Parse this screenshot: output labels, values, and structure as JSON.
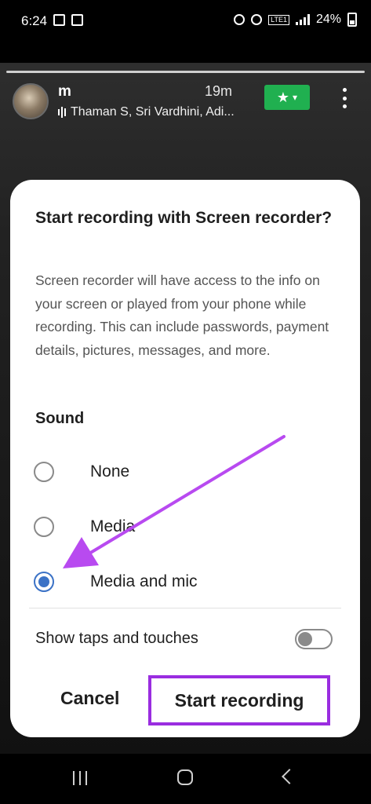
{
  "status_bar": {
    "time": "6:24",
    "network": "LTE1",
    "battery": "24%"
  },
  "app": {
    "chat_title": "m",
    "time_ago": "19m",
    "participants": "Thaman S, Sri Vardhini, Adi...",
    "star_icon": "star-icon",
    "accent_color": "#20b050"
  },
  "dialog": {
    "title": "Start recording with Screen recorder?",
    "description": "Screen recorder will have access to the info on your screen or played from your phone while recording. This can include passwords, payment details, pictures, messages, and more.",
    "sound_heading": "Sound",
    "sound_options": [
      {
        "label": "None",
        "selected": false
      },
      {
        "label": "Media",
        "selected": false
      },
      {
        "label": "Media and mic",
        "selected": true
      }
    ],
    "show_taps_label": "Show taps and touches",
    "show_taps_enabled": false,
    "cancel_label": "Cancel",
    "start_label": "Start recording",
    "highlight_color": "#9a2de0",
    "radio_color": "#3b72c6"
  }
}
